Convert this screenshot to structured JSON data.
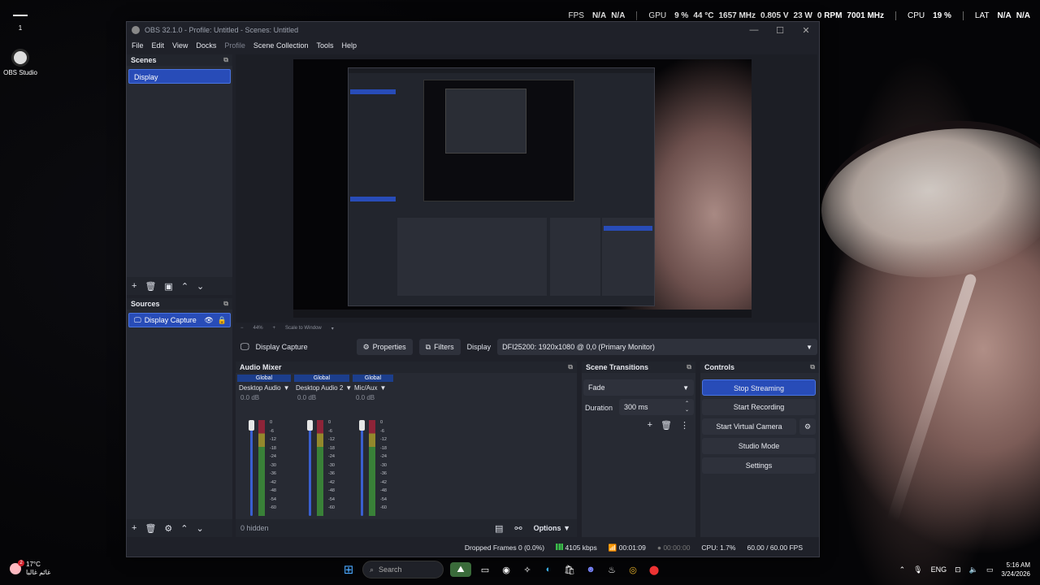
{
  "overlay": {
    "fps_label": "FPS",
    "fps_a": "N/A",
    "fps_b": "N/A",
    "gpu_label": "GPU",
    "gpu_load": "9 %",
    "gpu_temp": "44 °C",
    "gpu_clock": "1657 MHz",
    "gpu_volt": "0.805 V",
    "gpu_power": "23 W",
    "gpu_fan": "0 RPM",
    "gpu_mem": "7001 MHz",
    "cpu_label": "CPU",
    "cpu_load": "19 %",
    "lat_label": "LAT",
    "lat_a": "N/A",
    "lat_b": "N/A"
  },
  "desktop": {
    "network_number": "1",
    "obs_icon_label": "OBS Studio"
  },
  "window": {
    "title": "OBS 32.1.0 - Profile: Untitled - Scenes: Untitled",
    "controls": [
      "—",
      "☐",
      "✕"
    ]
  },
  "menu": [
    "File",
    "Edit",
    "View",
    "Docks",
    "Profile",
    "Scene Collection",
    "Tools",
    "Help"
  ],
  "scenes": {
    "title": "Scenes",
    "items": [
      "Display"
    ]
  },
  "sources": {
    "title": "Sources",
    "items": [
      "Display Capture"
    ]
  },
  "preview_toolbar": {
    "zoom": "44%",
    "scale": "Scale to Window"
  },
  "source_toolbar": {
    "source_name": "Display Capture",
    "properties": "Properties",
    "filters": "Filters",
    "display_label": "Display",
    "display_value": "DFI25200: 1920x1080 @ 0,0 (Primary Monitor)"
  },
  "mixer": {
    "title": "Audio Mixer",
    "ticks": [
      "0",
      "-6",
      "-12",
      "-18",
      "-24",
      "-30",
      "-36",
      "-42",
      "-48",
      "-54",
      "-60"
    ],
    "channels": [
      {
        "global": "Global",
        "name": "Desktop Audio",
        "db": "0.0 dB"
      },
      {
        "global": "Global",
        "name": "Desktop Audio 2",
        "db": "0.0 dB"
      },
      {
        "global": "Global",
        "name": "Mic/Aux",
        "db": "0.0 dB"
      }
    ],
    "options": "Options",
    "hidden": "0 hidden"
  },
  "transitions": {
    "title": "Scene Transitions",
    "type": "Fade",
    "duration_label": "Duration",
    "duration_value": "300 ms"
  },
  "controls": {
    "title": "Controls",
    "stop_streaming": "Stop Streaming",
    "start_recording": "Start Recording",
    "start_virtual_camera": "Start Virtual Camera",
    "studio_mode": "Studio Mode",
    "settings": "Settings"
  },
  "status": {
    "dropped": "Dropped Frames 0 (0.0%)",
    "bitrate": "4105 kbps",
    "stream_time": "00:01:09",
    "rec_time": "00:00:00",
    "cpu": "CPU: 1.7%",
    "fps": "60.00 / 60.00 FPS"
  },
  "taskbar": {
    "weather_temp": "17°C",
    "weather_desc": "غائم غالبا",
    "weather_badge": "2",
    "search": "Search",
    "lang": "ENG",
    "time": "5:16 AM",
    "date": "3/24/2026"
  },
  "colors": {
    "accent": "#284cb8",
    "panel": "#272a33",
    "window": "#1f2129",
    "meter_green": "#3f9e3a",
    "meter_red": "#b0223a"
  }
}
